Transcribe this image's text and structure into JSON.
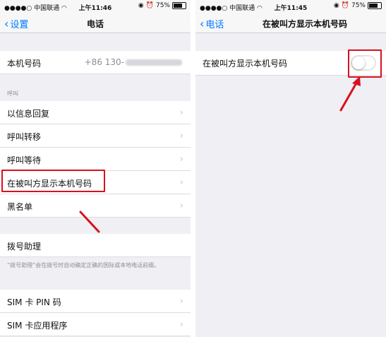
{
  "left": {
    "status": {
      "carrier": "中国联通",
      "time": "上午11:46",
      "battery": "75%"
    },
    "nav": {
      "back_label": "设置",
      "title": "电话"
    },
    "my_number": {
      "label": "本机号码",
      "value": "+86 130-"
    },
    "section_header": "呼叫",
    "call_items": [
      {
        "label": "以信息回复"
      },
      {
        "label": "呼叫转移"
      },
      {
        "label": "呼叫等待"
      },
      {
        "label": "在被叫方显示本机号码"
      },
      {
        "label": "黑名单"
      }
    ],
    "dial_assist": {
      "label": "拨号助理",
      "note": "“拨号助理”会在拨号时自动确定正确的国际或本地电话前缀。"
    },
    "sim_items": [
      {
        "label": "SIM 卡 PIN 码"
      },
      {
        "label": "SIM 卡应用程序"
      }
    ]
  },
  "right": {
    "status": {
      "carrier": "中国联通",
      "time": "上午11:45",
      "battery": "75%"
    },
    "nav": {
      "back_label": "电话",
      "title": "在被叫方显示本机号码"
    },
    "toggle_row": {
      "label": "在被叫方显示本机号码",
      "state": "off"
    }
  },
  "colors": {
    "accent": "#007aff",
    "highlight": "#d8111e",
    "background": "#efeff4"
  }
}
